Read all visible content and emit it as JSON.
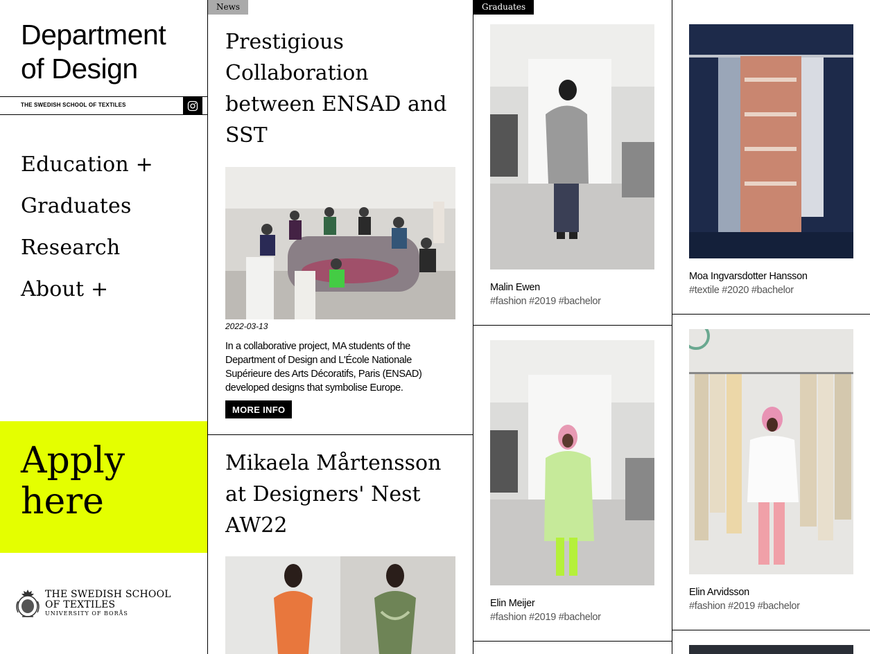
{
  "sidebar": {
    "title_line1": "Department",
    "title_line2": "of Design",
    "subtitle": "THE SWEDISH SCHOOL OF TEXTILES",
    "instagram_icon": "instagram-icon",
    "nav": [
      "Education +",
      "Graduates",
      "Research",
      "About +"
    ],
    "apply_line1": "Apply",
    "apply_line2": "here",
    "apply_color": "#e4ff00",
    "logo_line1": "THE SWEDISH SCHOOL",
    "logo_line2": "OF TEXTILES",
    "logo_line3": "UNIVERSITY OF BORÅS"
  },
  "news": {
    "tag": "News",
    "items": [
      {
        "title": "Prestigious Collaboration between ENSAD and SST",
        "date": "2022-03-13",
        "excerpt": "In a collaborative project, MA students of the Department of Design and L'École Nationale Supérieure des Arts Décoratifs, Paris (ENSAD) developed designs that symbolise Europe.",
        "button": "MORE INFO"
      },
      {
        "title": "Mikaela Mårtensson at Designers' Nest AW22"
      }
    ]
  },
  "graduates": {
    "tag": "Graduates",
    "items": [
      {
        "name": "Malin Ewen",
        "tags": "#fashion #2019 #bachelor"
      },
      {
        "name": "Moa Ingvarsdotter Hansson",
        "tags": "#textile #2020 #bachelor"
      },
      {
        "name": "Elin Meijer",
        "tags": "#fashion #2019 #bachelor"
      },
      {
        "name": "Elin Arvidsson",
        "tags": "#fashion #2019 #bachelor"
      }
    ]
  }
}
